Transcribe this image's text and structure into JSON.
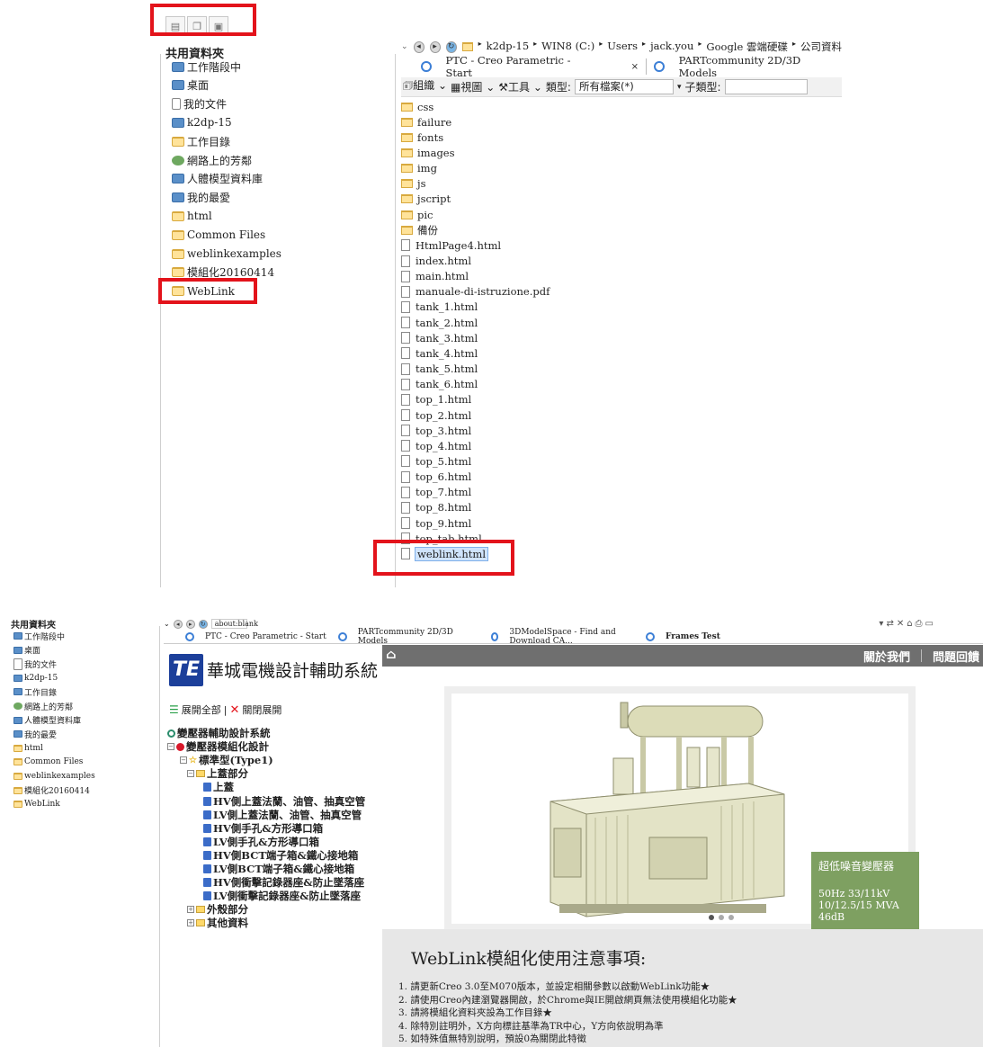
{
  "top": {
    "toolbar_icons": [
      "tree-icon",
      "folder-open-icon",
      "working-dir-icon"
    ],
    "common_folders_title": "共用資料夾",
    "common_folders": [
      {
        "label": "工作階段中",
        "icon": "session-icon"
      },
      {
        "label": "桌面",
        "icon": "desktop-icon"
      },
      {
        "label": "我的文件",
        "icon": "documents-icon"
      },
      {
        "label": "k2dp-15",
        "icon": "computer-icon"
      },
      {
        "label": "工作目錄",
        "icon": "working-dir-icon"
      },
      {
        "label": "網路上的芳鄰",
        "icon": "network-icon"
      },
      {
        "label": "人體模型資料庫",
        "icon": "manikin-icon"
      },
      {
        "label": "我的最愛",
        "icon": "favorites-icon"
      },
      {
        "label": "html",
        "icon": "folder-icon"
      },
      {
        "label": "Common Files",
        "icon": "folder-icon"
      },
      {
        "label": "weblinkexamples",
        "icon": "folder-icon"
      },
      {
        "label": "模組化20160414",
        "icon": "folder-icon"
      },
      {
        "label": "WebLink",
        "icon": "folder-icon"
      }
    ],
    "address": {
      "crumbs": [
        "k2dp-15",
        "WIN8 (C:)",
        "Users",
        "jack.you",
        "Google 雲端硬碟",
        "公司資料"
      ]
    },
    "tabs": [
      {
        "label": "PTC - Creo Parametric - Start",
        "close": "×"
      },
      {
        "label": "PARTcommunity 2D/3D Models"
      }
    ],
    "file_toolbar": {
      "organize": "組織",
      "views": "視圖",
      "tools": "工具",
      "type_label": "類型:",
      "type_value": "所有檔案(*)",
      "subtype_label": "子類型:",
      "subtype_value": ""
    },
    "files": [
      {
        "name": "css",
        "kind": "folder"
      },
      {
        "name": "failure",
        "kind": "folder"
      },
      {
        "name": "fonts",
        "kind": "folder"
      },
      {
        "name": "images",
        "kind": "folder"
      },
      {
        "name": "img",
        "kind": "folder"
      },
      {
        "name": "js",
        "kind": "folder"
      },
      {
        "name": "jscript",
        "kind": "folder"
      },
      {
        "name": "pic",
        "kind": "folder"
      },
      {
        "name": "備份",
        "kind": "folder"
      },
      {
        "name": "HtmlPage4.html",
        "kind": "file"
      },
      {
        "name": "index.html",
        "kind": "file"
      },
      {
        "name": "main.html",
        "kind": "file"
      },
      {
        "name": "manuale-di-istruzione.pdf",
        "kind": "file"
      },
      {
        "name": "tank_1.html",
        "kind": "file"
      },
      {
        "name": "tank_2.html",
        "kind": "file"
      },
      {
        "name": "tank_3.html",
        "kind": "file"
      },
      {
        "name": "tank_4.html",
        "kind": "file"
      },
      {
        "name": "tank_5.html",
        "kind": "file"
      },
      {
        "name": "tank_6.html",
        "kind": "file"
      },
      {
        "name": "top_1.html",
        "kind": "file"
      },
      {
        "name": "top_2.html",
        "kind": "file"
      },
      {
        "name": "top_3.html",
        "kind": "file"
      },
      {
        "name": "top_4.html",
        "kind": "file"
      },
      {
        "name": "top_5.html",
        "kind": "file"
      },
      {
        "name": "top_6.html",
        "kind": "file"
      },
      {
        "name": "top_7.html",
        "kind": "file"
      },
      {
        "name": "top_8.html",
        "kind": "file"
      },
      {
        "name": "top_9.html",
        "kind": "file"
      },
      {
        "name": "top_tab.html",
        "kind": "file"
      },
      {
        "name": "weblink.html",
        "kind": "file",
        "selected": true
      }
    ]
  },
  "bottom": {
    "common_folders_title": "共用資料夾",
    "common_folders": [
      "工作階段中",
      "桌面",
      "我的文件",
      "k2dp-15",
      "工作目錄",
      "網路上的芳鄰",
      "人體模型資料庫",
      "我的最愛",
      "html",
      "Common Files",
      "weblinkexamples",
      "模組化20160414",
      "WebLink"
    ],
    "address": "about:blank",
    "tabs": [
      {
        "label": "PTC - Creo Parametric - Start"
      },
      {
        "label": "PARTcommunity 2D/3D Models"
      },
      {
        "label": "3DModelSpace - Find and Download CA..."
      },
      {
        "label": "Frames Test"
      }
    ],
    "site": {
      "logo_text": "華城電機設計輔助系統",
      "logo_mark": "TE",
      "nav": [
        "關於我們",
        "問題回饋"
      ],
      "expand_all": "展開全部",
      "separator": "|",
      "collapse_all": "關閉展開",
      "tree": [
        {
          "label": "變壓器輔助設計系統",
          "level": 0,
          "icon": "ring"
        },
        {
          "label": "變壓器模組化設計",
          "level": 0,
          "icon": "gear",
          "toggle": "⊟"
        },
        {
          "label": "標準型(Type1)",
          "level": 1,
          "icon": "star",
          "toggle": "⊟"
        },
        {
          "label": "上蓋部分",
          "level": 2,
          "icon": "folder",
          "toggle": "⊟"
        },
        {
          "label": "上蓋",
          "level": 3,
          "icon": "page"
        },
        {
          "label": "HV側上蓋法蘭、油管、抽真空管",
          "level": 3,
          "icon": "page"
        },
        {
          "label": "LV側上蓋法蘭、油管、抽真空管",
          "level": 3,
          "icon": "page"
        },
        {
          "label": "HV側手孔&方形導口箱",
          "level": 3,
          "icon": "page"
        },
        {
          "label": "LV側手孔&方形導口箱",
          "level": 3,
          "icon": "page"
        },
        {
          "label": "HV側BCT端子箱&鐵心接地箱",
          "level": 3,
          "icon": "page"
        },
        {
          "label": "LV側BCT端子箱&鐵心接地箱",
          "level": 3,
          "icon": "page"
        },
        {
          "label": "HV側衝擊記錄器座&防止墜落座",
          "level": 3,
          "icon": "page"
        },
        {
          "label": "LV側衝擊記錄器座&防止墜落座",
          "level": 3,
          "icon": "page"
        },
        {
          "label": "外殼部分",
          "level": 2,
          "icon": "folder",
          "toggle": "⊞"
        },
        {
          "label": "其他資料",
          "level": 2,
          "icon": "folder",
          "toggle": "⊞"
        }
      ],
      "banner_caption": {
        "title": "超低噪音變壓器",
        "lines": [
          "50Hz 33/11kV",
          "10/12.5/15 MVA",
          "46dB"
        ]
      },
      "notes_title": "WebLink模組化使用注意事項:",
      "notes": [
        "1. 請更新Creo 3.0至M070版本，並設定相關參數以啟動WebLink功能★",
        "2. 請使用Creo內建瀏覽器開啟，於Chrome與IE開啟網頁無法使用模組化功能★",
        "3. 請將模組化資料夾設為工作目錄★",
        "4. 除特別註明外，X方向標註基準為TR中心，Y方向依說明為準",
        "5. 如特殊值無特別說明，預設0為關閉此特徵"
      ]
    }
  }
}
